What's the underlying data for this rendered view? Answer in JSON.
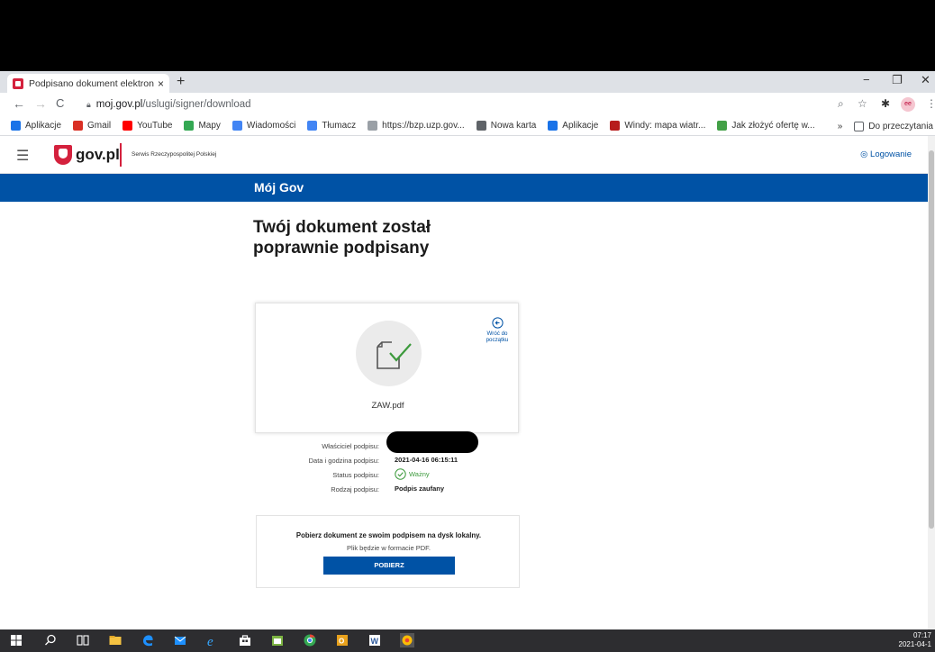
{
  "browser": {
    "tab_title": "Podpisano dokument elektronicz",
    "tab_close": "×",
    "new_tab": "+",
    "window_controls": {
      "minimize": "−",
      "restore": "❐",
      "close": "✕"
    },
    "nav": {
      "back": "←",
      "forward": "→",
      "reload": "C"
    },
    "url_host": "moj.gov.pl",
    "url_path": "/uslugi/signer/download"
  },
  "bookmarks": {
    "items": [
      {
        "label": "Aplikacje",
        "color": "#1a73e8"
      },
      {
        "label": "Gmail",
        "color": "#d93025"
      },
      {
        "label": "YouTube",
        "color": "#ff0000"
      },
      {
        "label": "Mapy",
        "color": "#34a853"
      },
      {
        "label": "Wiadomości",
        "color": "#4285f4"
      },
      {
        "label": "Tłumacz",
        "color": "#4285f4"
      },
      {
        "label": "https://bzp.uzp.gov...",
        "color": "#9aa0a6"
      },
      {
        "label": "Nowa karta",
        "color": "#5f6368"
      },
      {
        "label": "Aplikacje",
        "color": "#1a73e8"
      },
      {
        "label": "Windy: mapa wiatr...",
        "color": "#b71c1c"
      },
      {
        "label": "Jak złożyć ofertę w...",
        "color": "#43a047"
      }
    ],
    "overflow": "»",
    "reading_list": "Do przeczytania"
  },
  "gov_header": {
    "logo_text": "gov.pl",
    "tagline": "Serwis Rzeczypospolitej Polskiej",
    "login_label": "Logowanie"
  },
  "band": {
    "title": "Mój Gov"
  },
  "page": {
    "title_line1": "Twój dokument został",
    "title_line2": "poprawnie podpisany"
  },
  "document": {
    "filename": "ZAW.pdf",
    "back_line1": "Wróć do",
    "back_line2": "początku"
  },
  "signature": {
    "owner_label": "Właściciel podpisu:",
    "date_label": "Data i godzina podpisu:",
    "date_value": "2021-04-16 06:15:11",
    "status_label": "Status podpisu:",
    "status_value": "Ważny",
    "type_label": "Rodzaj podpisu:",
    "type_value": "Podpis zaufany"
  },
  "download": {
    "heading": "Pobierz dokument ze swoim podpisem na dysk lokalny.",
    "note": "Plik będzie w formacie PDF.",
    "button": "POBIERZ"
  },
  "taskbar": {
    "time": "07:17",
    "date": "2021-04-1"
  },
  "colors": {
    "gov_blue": "#0052a5",
    "gov_red": "#d4213d",
    "valid_green": "#3c9a3c"
  }
}
